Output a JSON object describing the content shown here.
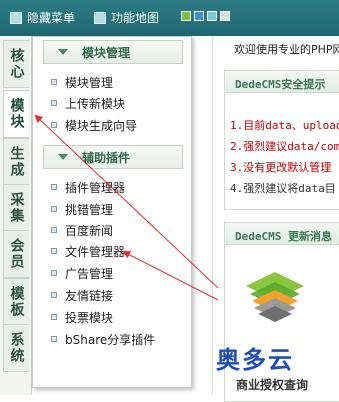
{
  "topbar": {
    "hide_menu": "隐藏菜单",
    "site_map": "功能地图",
    "skin_colors": [
      "#7fc03e",
      "#3e8fd1",
      "#7cc9d6",
      "#dddddd"
    ]
  },
  "leftnav": {
    "items": [
      "核心",
      "模块",
      "生成",
      "采集",
      "会员",
      "模板",
      "系统"
    ],
    "active_index": 1
  },
  "menu": {
    "sections": [
      {
        "title": "模块管理",
        "items": [
          "模块管理",
          "上传新模块",
          "模块生成向导"
        ]
      },
      {
        "title": "辅助插件",
        "items": [
          "插件管理器",
          "挑错管理",
          "百度新闻",
          "文件管理器",
          "广告管理",
          "友情链接",
          "投票模块",
          "bShare分享插件"
        ]
      }
    ]
  },
  "content": {
    "welcome": "欢迎使用专业的PHP网",
    "security_title": "DedeCMS安全提示",
    "tips": [
      {
        "text": "1.目前data、upload",
        "color": "#c80000"
      },
      {
        "text": "2.强烈建议data/com",
        "color": "#c80000"
      },
      {
        "text": "3.没有更改默认管理",
        "color": "#c80000"
      },
      {
        "text": "4.强烈建议将data目",
        "color": "#333333"
      }
    ],
    "update_title": "DedeCMS 更新消息",
    "watermark": "奥多云",
    "license": "商业授权查询"
  }
}
